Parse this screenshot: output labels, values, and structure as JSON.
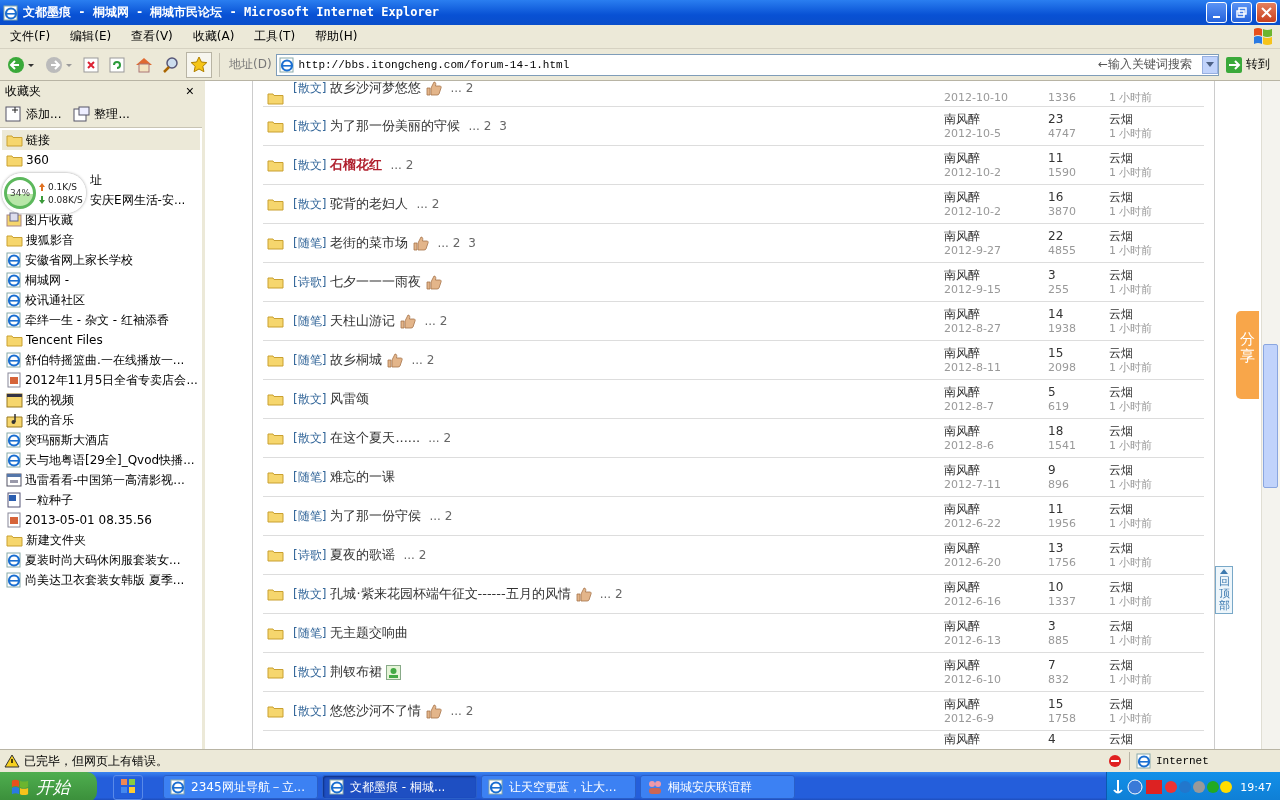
{
  "window": {
    "title": "文都墨痕 - 桐城网 - 桐城市民论坛 - Microsoft Internet Explorer"
  },
  "menu": [
    "文件(F)",
    "编辑(E)",
    "查看(V)",
    "收藏(A)",
    "工具(T)",
    "帮助(H)"
  ],
  "address": {
    "label": "地址(D)",
    "url": "http://bbs.itongcheng.com/forum-14-1.html",
    "search_placeholder": "←输入关键词搜索",
    "go": "转到"
  },
  "favorites": {
    "title": "收藏夹",
    "close": "×",
    "add": "添加...",
    "organize": "整理...",
    "items": [
      {
        "label": "链接",
        "kind": "folder",
        "selected": true,
        "obscured": false
      },
      {
        "label": "360",
        "kind": "folder",
        "selected": false,
        "obscured": false
      },
      {
        "label": "址",
        "selected": false,
        "obscured": true
      },
      {
        "label": "安庆E网生活-安...",
        "selected": false,
        "obscured": true
      },
      {
        "label": "图片收藏",
        "kind": "image",
        "selected": false,
        "obscured": false
      },
      {
        "label": "搜狐影音",
        "kind": "folder",
        "selected": false,
        "obscured": false
      },
      {
        "label": "安徽省网上家长学校",
        "kind": "ie",
        "selected": false,
        "obscured": false
      },
      {
        "label": "桐城网 -",
        "kind": "ie",
        "selected": false,
        "obscured": false
      },
      {
        "label": "校讯通社区",
        "kind": "ie",
        "selected": false,
        "obscured": false
      },
      {
        "label": "牵绊一生 - 杂文 - 红袖添香",
        "kind": "ie",
        "selected": false,
        "obscured": false
      },
      {
        "label": "Tencent Files",
        "kind": "folder",
        "selected": false,
        "obscured": false
      },
      {
        "label": "舒伯特摇篮曲.一在线播放一...",
        "kind": "ie",
        "selected": false,
        "obscured": false
      },
      {
        "label": "2012年11月5日全省专卖店会...",
        "kind": "doc",
        "selected": false,
        "obscured": false
      },
      {
        "label": "我的视频",
        "kind": "video",
        "selected": false,
        "obscured": false
      },
      {
        "label": "我的音乐",
        "kind": "music",
        "selected": false,
        "obscured": false
      },
      {
        "label": "突玛丽斯大酒店",
        "kind": "ie",
        "selected": false,
        "obscured": false
      },
      {
        "label": "天与地粤语[29全]_Qvod快播...",
        "kind": "ie",
        "selected": false,
        "obscured": false
      },
      {
        "label": "迅雷看看-中国第一高清影视...",
        "kind": "app",
        "selected": false,
        "obscured": false
      },
      {
        "label": "一粒种子",
        "kind": "word",
        "selected": false,
        "obscured": false
      },
      {
        "label": "2013-05-01 08.35.56",
        "kind": "doc",
        "selected": false,
        "obscured": false
      },
      {
        "label": "新建文件夹",
        "kind": "folder",
        "selected": false,
        "obscured": false
      },
      {
        "label": "夏装时尚大码休闲服套装女...",
        "kind": "ie",
        "selected": false,
        "obscured": false
      },
      {
        "label": "尚美达卫衣套装女韩版 夏季...",
        "kind": "ie",
        "selected": false,
        "obscured": false
      }
    ]
  },
  "speed_widget": {
    "percent": "34%",
    "up": "0.1K/S",
    "down": "0.08K/S"
  },
  "threads": [
    {
      "kind": "cut_top",
      "tag": "[散文]",
      "title": "故乡沙河梦悠悠",
      "highlight": false,
      "badge": {
        "kind": "thumb"
      },
      "pages": [
        "... 2"
      ],
      "date": "2012-10-10",
      "views": "1336",
      "last_time": "1 小时前"
    },
    {
      "kind": "full",
      "tag": "[散文]",
      "title": "为了那一份美丽的守候",
      "highlight": false,
      "pages": [
        "... 2",
        "3"
      ],
      "author": "南风醉",
      "date": "2012-10-5",
      "replies": "23",
      "views": "4747",
      "last_poster": "云烟",
      "last_time": "1 小时前"
    },
    {
      "kind": "full",
      "tag": "[散文]",
      "title": "石榴花红",
      "highlight": true,
      "pages": [
        "... 2"
      ],
      "author": "南风醉",
      "date": "2012-10-2",
      "replies": "11",
      "views": "1590",
      "last_poster": "云烟",
      "last_time": "1 小时前"
    },
    {
      "kind": "full",
      "tag": "[散文]",
      "title": "驼背的老妇人",
      "highlight": false,
      "pages": [
        "... 2"
      ],
      "author": "南风醉",
      "date": "2012-10-2",
      "replies": "16",
      "views": "3870",
      "last_poster": "云烟",
      "last_time": "1 小时前"
    },
    {
      "kind": "full",
      "tag": "[随笔]",
      "title": "老街的菜市场",
      "highlight": false,
      "badge": {
        "kind": "thumb"
      },
      "pages": [
        "... 2",
        "3"
      ],
      "author": "南风醉",
      "date": "2012-9-27",
      "replies": "22",
      "views": "4855",
      "last_poster": "云烟",
      "last_time": "1 小时前"
    },
    {
      "kind": "full",
      "tag": "[诗歌]",
      "title": "七夕一一一雨夜",
      "highlight": false,
      "badge": {
        "kind": "thumb"
      },
      "author": "南风醉",
      "date": "2012-9-15",
      "replies": "3",
      "views": "255",
      "last_poster": "云烟",
      "last_time": "1 小时前"
    },
    {
      "kind": "full",
      "tag": "[随笔]",
      "title": "天柱山游记",
      "highlight": false,
      "badge": {
        "kind": "thumb"
      },
      "pages": [
        "... 2"
      ],
      "author": "南风醉",
      "date": "2012-8-27",
      "replies": "14",
      "views": "1938",
      "last_poster": "云烟",
      "last_time": "1 小时前"
    },
    {
      "kind": "full",
      "tag": "[随笔]",
      "title": "故乡桐城",
      "highlight": false,
      "badge": {
        "kind": "thumb"
      },
      "pages": [
        "... 2"
      ],
      "author": "南风醉",
      "date": "2012-8-11",
      "replies": "15",
      "views": "2098",
      "last_poster": "云烟",
      "last_time": "1 小时前"
    },
    {
      "kind": "full",
      "tag": "[散文]",
      "title": "风雷颂",
      "highlight": false,
      "author": "南风醉",
      "date": "2012-8-7",
      "replies": "5",
      "views": "619",
      "last_poster": "云烟",
      "last_time": "1 小时前"
    },
    {
      "kind": "full",
      "tag": "[散文]",
      "title": "在这个夏天......",
      "highlight": false,
      "pages": [
        "... 2"
      ],
      "author": "南风醉",
      "date": "2012-8-6",
      "replies": "18",
      "views": "1541",
      "last_poster": "云烟",
      "last_time": "1 小时前"
    },
    {
      "kind": "full",
      "tag": "[随笔]",
      "title": "难忘的一课",
      "highlight": false,
      "author": "南风醉",
      "date": "2012-7-11",
      "replies": "9",
      "views": "896",
      "last_poster": "云烟",
      "last_time": "1 小时前"
    },
    {
      "kind": "full",
      "tag": "[随笔]",
      "title": "为了那一份守侯",
      "highlight": false,
      "pages": [
        "... 2"
      ],
      "author": "南风醉",
      "date": "2012-6-22",
      "replies": "11",
      "views": "1956",
      "last_poster": "云烟",
      "last_time": "1 小时前"
    },
    {
      "kind": "full",
      "tag": "[诗歌]",
      "title": "夏夜的歌谣",
      "highlight": false,
      "pages": [
        "... 2"
      ],
      "author": "南风醉",
      "date": "2012-6-20",
      "replies": "13",
      "views": "1756",
      "last_poster": "云烟",
      "last_time": "1 小时前"
    },
    {
      "kind": "full",
      "tag": "[散文]",
      "title": "孔城·紫来花园杯端午征文------五月的风情",
      "highlight": false,
      "badge": {
        "kind": "thumb"
      },
      "pages": [
        "... 2"
      ],
      "author": "南风醉",
      "date": "2012-6-16",
      "replies": "10",
      "views": "1337",
      "last_poster": "云烟",
      "last_time": "1 小时前"
    },
    {
      "kind": "full",
      "tag": "[随笔]",
      "title": "无主题交响曲",
      "highlight": false,
      "author": "南风醉",
      "date": "2012-6-13",
      "replies": "3",
      "views": "885",
      "last_poster": "云烟",
      "last_time": "1 小时前"
    },
    {
      "kind": "full",
      "tag": "[散文]",
      "title": "荆钗布裙",
      "highlight": false,
      "badge": {
        "kind": "image"
      },
      "author": "南风醉",
      "date": "2012-6-10",
      "replies": "7",
      "views": "832",
      "last_poster": "云烟",
      "last_time": "1 小时前"
    },
    {
      "kind": "full",
      "tag": "[散文]",
      "title": "悠悠沙河不了情",
      "highlight": false,
      "badge": {
        "kind": "thumb"
      },
      "pages": [
        "... 2"
      ],
      "author": "南风醉",
      "date": "2012-6-9",
      "replies": "15",
      "views": "1758",
      "last_poster": "云烟",
      "last_time": "1 小时前"
    },
    {
      "kind": "cut_bottom",
      "author": "南风醉",
      "replies": "4",
      "last_poster": "云烟"
    }
  ],
  "side_tabs": {
    "share": "分享",
    "top": "回顶部"
  },
  "status_bar": {
    "text": "已完毕，但网页上有错误。",
    "zone": "Internet"
  },
  "taskbar": {
    "start": "开始",
    "tasks": [
      {
        "label": "2345网址导航－立...",
        "selected": false
      },
      {
        "label": "文都墨痕 - 桐城...",
        "selected": true
      },
      {
        "label": "让天空更蓝，让大...",
        "selected": false
      },
      {
        "label": "桐城安庆联谊群",
        "selected": false,
        "kind": "people"
      }
    ],
    "clock": "19:47"
  }
}
